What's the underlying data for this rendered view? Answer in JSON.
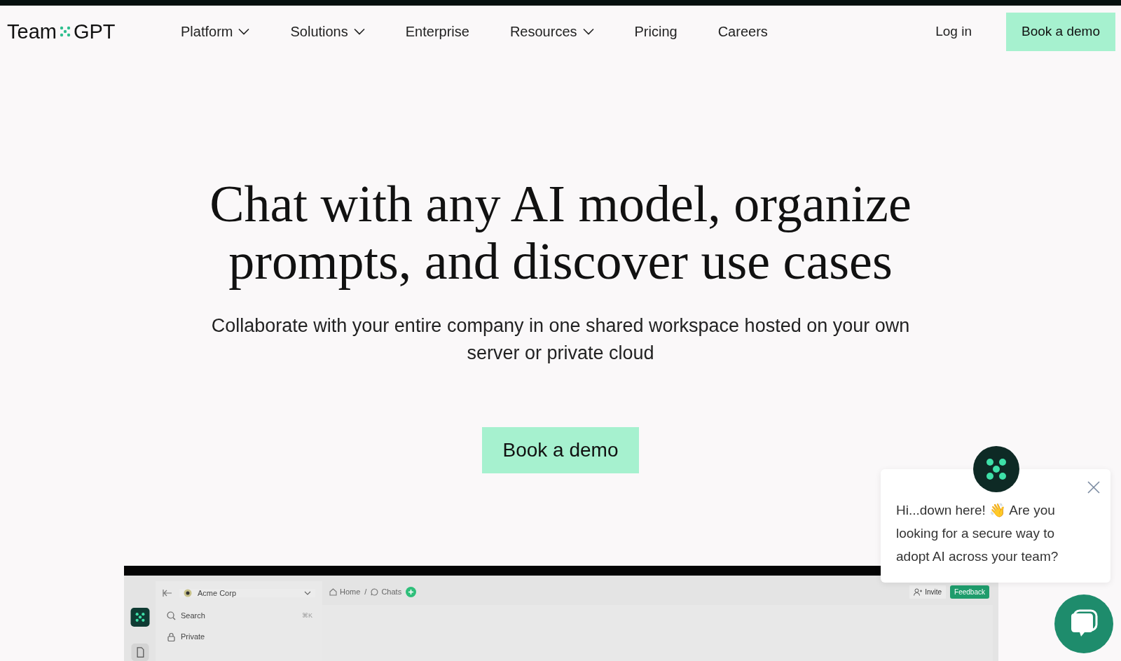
{
  "nav": {
    "logo": {
      "left": "Team",
      "right": "GPT"
    },
    "items": [
      {
        "label": "Platform",
        "dropdown": true
      },
      {
        "label": "Solutions",
        "dropdown": true
      },
      {
        "label": "Enterprise",
        "dropdown": false
      },
      {
        "label": "Resources",
        "dropdown": true
      },
      {
        "label": "Pricing",
        "dropdown": false
      },
      {
        "label": "Careers",
        "dropdown": false
      }
    ],
    "login": "Log in",
    "cta": "Book a demo"
  },
  "hero": {
    "title_lines": [
      "Chat with any AI model, organize",
      "prompts, and discover use cases"
    ],
    "subtitle": "Collaborate with your entire company in one shared workspace hosted on your own server or private cloud",
    "cta": "Book a demo"
  },
  "preview": {
    "workspace": "Acme Corp",
    "search": {
      "label": "Search",
      "shortcut": "⌘K"
    },
    "sidebar_items": [
      "Private"
    ],
    "breadcrumbs": [
      "Home",
      "Chats"
    ],
    "breadcrumb_separator": "/",
    "invite": "Invite",
    "feedback": "Feedback"
  },
  "chat": {
    "message": "Hi...down here! 👋 Are you looking for a secure way to adopt AI across your team?"
  }
}
